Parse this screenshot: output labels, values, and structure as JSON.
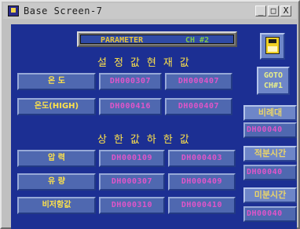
{
  "window": {
    "title": "Base Screen-7",
    "minimize": "_",
    "restore": "□",
    "close": "X"
  },
  "header": {
    "param_label": "PARAMETER",
    "channel": "CH #2"
  },
  "sections": {
    "current_title": "설정값현재값",
    "limit_title": "상한값하한값"
  },
  "current_rows": [
    {
      "label": "온 도",
      "set_value": "DH000307",
      "present_value": "DH000407"
    },
    {
      "label": "온도(HIGH)",
      "set_value": "DH000416",
      "present_value": "DH000407"
    }
  ],
  "limit_rows": [
    {
      "label": "압 력",
      "upper": "DH000109",
      "lower": "DH000403"
    },
    {
      "label": "유 량",
      "upper": "DH000307",
      "lower": "DH000409"
    },
    {
      "label": "비저항값",
      "upper": "DH000310",
      "lower": "DH000410"
    }
  ],
  "right_panel": {
    "goto_line1": "GOTO",
    "goto_line2": "CH#1",
    "buttons": [
      {
        "label": "비례대",
        "value": "DH00040"
      },
      {
        "label": "적분시간",
        "value": "DH00040"
      },
      {
        "label": "미분시간",
        "value": "DH00040"
      }
    ]
  },
  "colors": {
    "panel": "#1c2f93",
    "cell": "#4f68b0",
    "label": "#ffe34a",
    "value": "#e055c9"
  }
}
